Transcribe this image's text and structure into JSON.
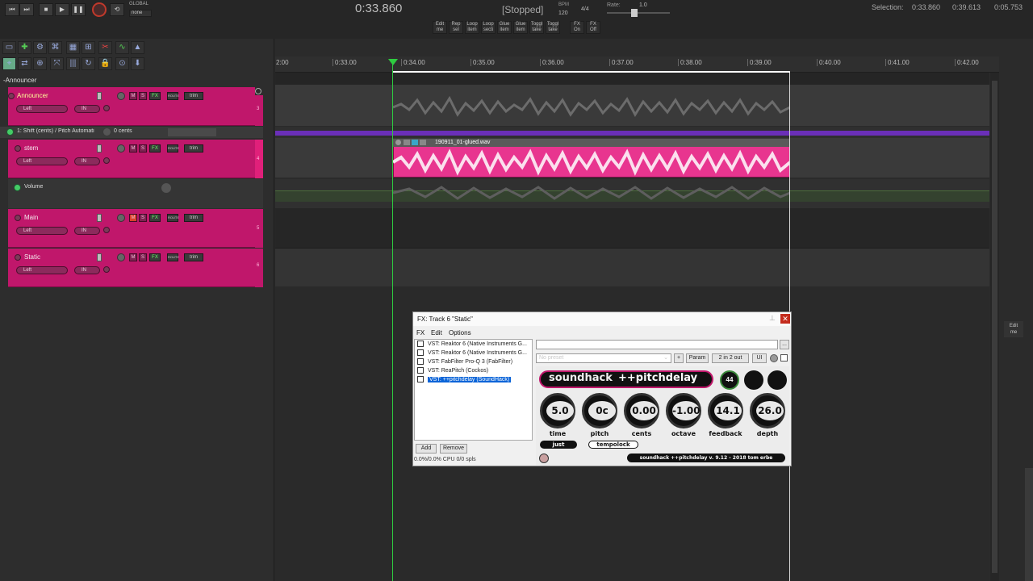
{
  "transport": {
    "global_label": "GLOBAL",
    "global_mode": "none",
    "time": "0:33.860",
    "state": "[Stopped]",
    "bpm_label": "BPM",
    "bpm": "120",
    "time_sig": "4/4",
    "rate_label": "Rate:",
    "rate": "1.0",
    "selection_label": "Selection:",
    "sel_start": "0:33.860",
    "sel_end": "0:39.613",
    "sel_len": "0:05.753"
  },
  "toolbar_mini": [
    {
      "l1": "Edit",
      "l2": "me"
    },
    {
      "l1": "Rep",
      "l2": "sel"
    },
    {
      "l1": "Loop",
      "l2": "item"
    },
    {
      "l1": "Loop",
      "l2": "secti"
    },
    {
      "l1": "Glue",
      "l2": "item"
    },
    {
      "l1": "Glue",
      "l2": "item"
    },
    {
      "l1": "Toggl",
      "l2": "take"
    },
    {
      "l1": "Toggl",
      "l2": "take"
    },
    {
      "l1": "FX",
      "l2": "On"
    },
    {
      "l1": "FX",
      "l2": "Off"
    }
  ],
  "ruler": [
    "2:00",
    "0:33.00",
    "0:34.00",
    "0:35.00",
    "0:36.00",
    "0:37.00",
    "0:38.00",
    "0:39.00",
    "0:40.00",
    "0:41.00",
    "0:42.00"
  ],
  "folder_label": "-Announcer",
  "tracks": [
    {
      "name": "Announcer",
      "io": "Left",
      "num": "3"
    },
    {
      "name": "stem",
      "io": "Left",
      "num": "4"
    },
    {
      "name": "Main",
      "io": "Left",
      "num": "5"
    },
    {
      "name": "Static",
      "io": "Left",
      "num": "6"
    }
  ],
  "envelopes": {
    "pitch": {
      "label": "1: Shift (cents) / Pitch Automati",
      "value": "0 cents"
    },
    "volume": {
      "label": "Volume"
    }
  },
  "track_buttons": {
    "m": "M",
    "s": "S",
    "fx": "FX",
    "route": "ROUTE",
    "trim": "trim",
    "in": "IN"
  },
  "item": {
    "name": "190911_01-glued.wav"
  },
  "right_edge": {
    "edit_l1": "Edit",
    "edit_l2": "me"
  },
  "fx_window": {
    "title": "FX: Track 6 \"Static\"",
    "menu": [
      "FX",
      "Edit",
      "Options"
    ],
    "plugins": [
      "VST: Reaktor 6 (Native Instruments G...",
      "VST: Reaktor 6 (Native Instruments G...",
      "VST: FabFilter Pro-Q 3 (FabFilter)",
      "VST: ReaPitch (Cockos)",
      "VST: ++pitchdelay (SoundHack)"
    ],
    "selected_index": 4,
    "add_label": "Add",
    "remove_label": "Remove",
    "cpu": "0.0%/0.0% CPU 0/0 spls",
    "preset": "No preset",
    "plus": "+",
    "param_label": "Param",
    "io_label": "2 in 2 out",
    "ui_label": "UI",
    "more_label": "..."
  },
  "plugin": {
    "brand": "soundhack",
    "name": "++pitchdelay",
    "badge": "44",
    "knobs": [
      {
        "label": "time",
        "value": "5.0"
      },
      {
        "label": "pitch",
        "value": "0c"
      },
      {
        "label": "cents",
        "value": "0.00"
      },
      {
        "label": "octave",
        "value": "-1.00"
      },
      {
        "label": "feedback",
        "value": "14.1"
      },
      {
        "label": "depth",
        "value": "26.0"
      }
    ],
    "just_label": "just",
    "tempolock_label": "tempolock",
    "footer": "soundhack ++pitchdelay v. 9.12 - 2018 tom erbe"
  },
  "colors": {
    "track": "#c0176b",
    "item": "#e8358f",
    "envelope": "#6a2fb8",
    "bg": "#2b2b2b"
  }
}
